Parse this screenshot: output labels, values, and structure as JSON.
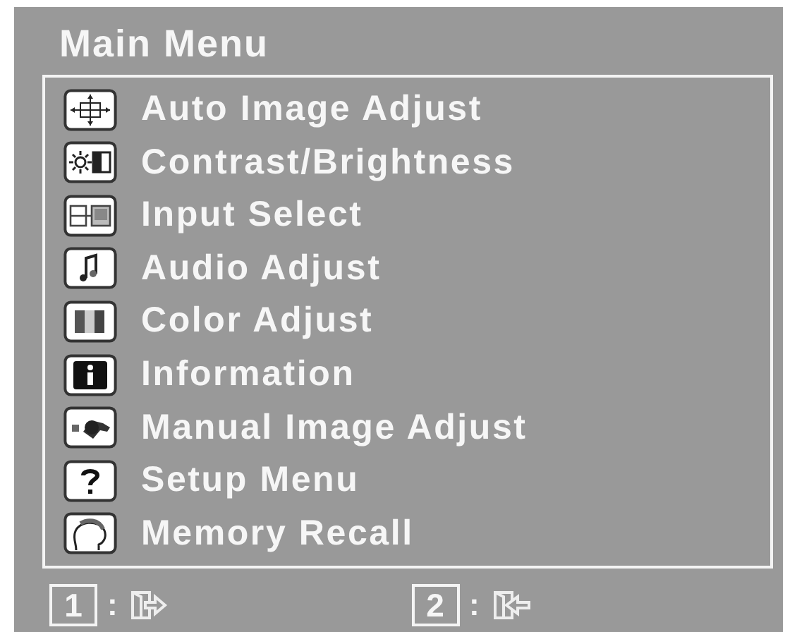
{
  "title": "Main Menu",
  "items": [
    {
      "label": "Auto Image Adjust"
    },
    {
      "label": "Contrast/Brightness"
    },
    {
      "label": "Input Select"
    },
    {
      "label": "Audio Adjust"
    },
    {
      "label": "Color Adjust"
    },
    {
      "label": "Information"
    },
    {
      "label": "Manual Image Adjust"
    },
    {
      "label": "Setup Menu"
    },
    {
      "label": "Memory Recall"
    }
  ],
  "footer": [
    {
      "key": "1",
      "separator": ":"
    },
    {
      "key": "2",
      "separator": ":"
    }
  ]
}
